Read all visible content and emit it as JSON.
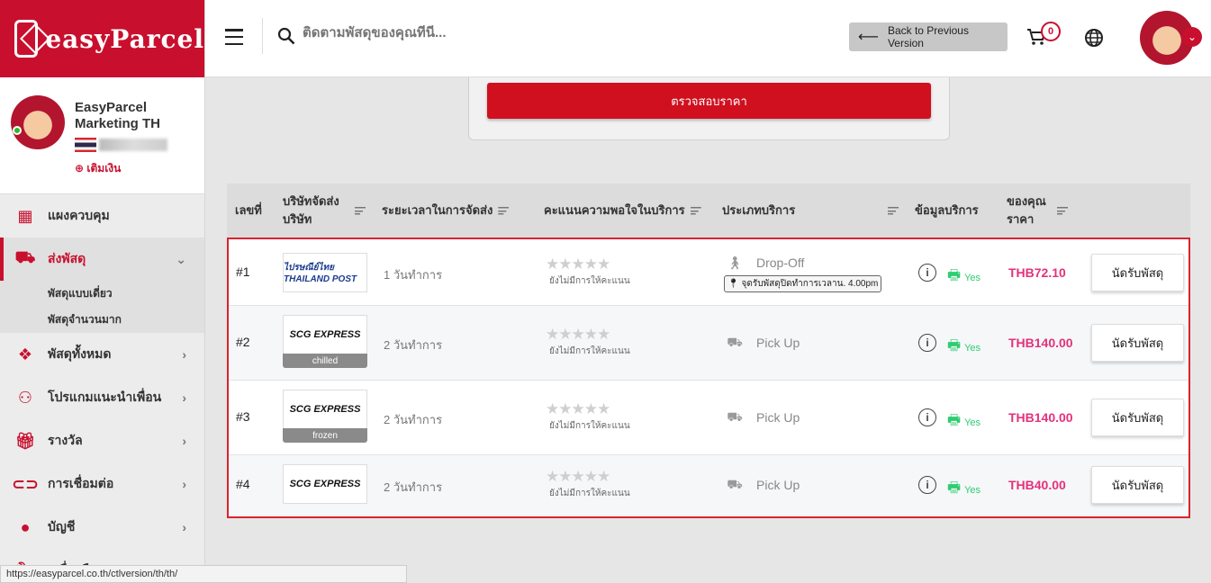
{
  "sidebar": {
    "logo": "easyParcel",
    "profile": {
      "name": "EasyParcel Marketing TH",
      "topup": "เติมเงิน"
    },
    "items": [
      {
        "label": "แผงควบคุม",
        "icon": "dashboard-icon"
      },
      {
        "label": "ส่งพัสดุ",
        "icon": "truck-icon"
      },
      {
        "label": "พัสดุทั้งหมด",
        "icon": "boxes-icon"
      },
      {
        "label": "โปรแกมแนะนำเพื่อน",
        "icon": "users-icon"
      },
      {
        "label": "รางวัล",
        "icon": "gift-icon"
      },
      {
        "label": "การเชื่อมต่อ",
        "icon": "link-icon"
      },
      {
        "label": "บัญชี",
        "icon": "user-icon"
      },
      {
        "label": "เครื่องมือ",
        "icon": "wrench-icon"
      }
    ],
    "sub_items": [
      "พัสดุแบบเดี่ยว",
      "พัสดุจำนวนมาก"
    ]
  },
  "url_status": "https://easyparcel.co.th/ctlversion/th/th/",
  "header": {
    "search_placeholder": "ติดตามพัสดุของคุณที่นี่...",
    "back_label": "Back to Previous Version",
    "cart_count": "0"
  },
  "check_price_label": "ตรวจสอบราคา",
  "table": {
    "headers": {
      "no": "เลขที่",
      "courier": "บริษัทจัดส่ง บริษัท",
      "duration": "ระยะเวลาในการจัดส่ง",
      "rating": "คะแนนความพอใจในบริการ",
      "service": "ประเภทบริการ",
      "info": "ข้อมูลบริการ",
      "price": "ของคุณ ราคา"
    },
    "rows": [
      {
        "no": "#1",
        "courier": "ไปรษณีย์ไทย THAILAND POST",
        "tag": "",
        "duration": "1 วันทำการ",
        "stars": "★★★★★",
        "rating_note": "ยังไม่มีการให้คะแนน",
        "service": "Drop-Off",
        "service_note": "จุดรับพัสดุปิดทำการเวลาน. 4.00pm",
        "print": "Yes",
        "price": "THB72.10",
        "action": "นัดรับพัสดุ"
      },
      {
        "no": "#2",
        "courier": "SCG EXPRESS",
        "tag": "chilled",
        "duration": "2 วันทำการ",
        "stars": "★★★★★",
        "rating_note": "ยังไม่มีการให้คะแนน",
        "service": "Pick Up",
        "service_note": "",
        "print": "Yes",
        "price": "THB140.00",
        "action": "นัดรับพัสดุ"
      },
      {
        "no": "#3",
        "courier": "SCG EXPRESS",
        "tag": "frozen",
        "duration": "2 วันทำการ",
        "stars": "★★★★★",
        "rating_note": "ยังไม่มีการให้คะแนน",
        "service": "Pick Up",
        "service_note": "",
        "print": "Yes",
        "price": "THB140.00",
        "action": "นัดรับพัสดุ"
      },
      {
        "no": "#4",
        "courier": "SCG EXPRESS",
        "tag": "",
        "duration": "2 วันทำการ",
        "stars": "★★★★★",
        "rating_note": "ยังไม่มีการให้คะแนน",
        "service": "Pick Up",
        "service_note": "",
        "print": "Yes",
        "price": "THB40.00",
        "action": "นัดรับพัสดุ"
      }
    ]
  },
  "colors": {
    "brand": "#c8102e",
    "price": "#e4317b",
    "print": "#2ecc71"
  }
}
